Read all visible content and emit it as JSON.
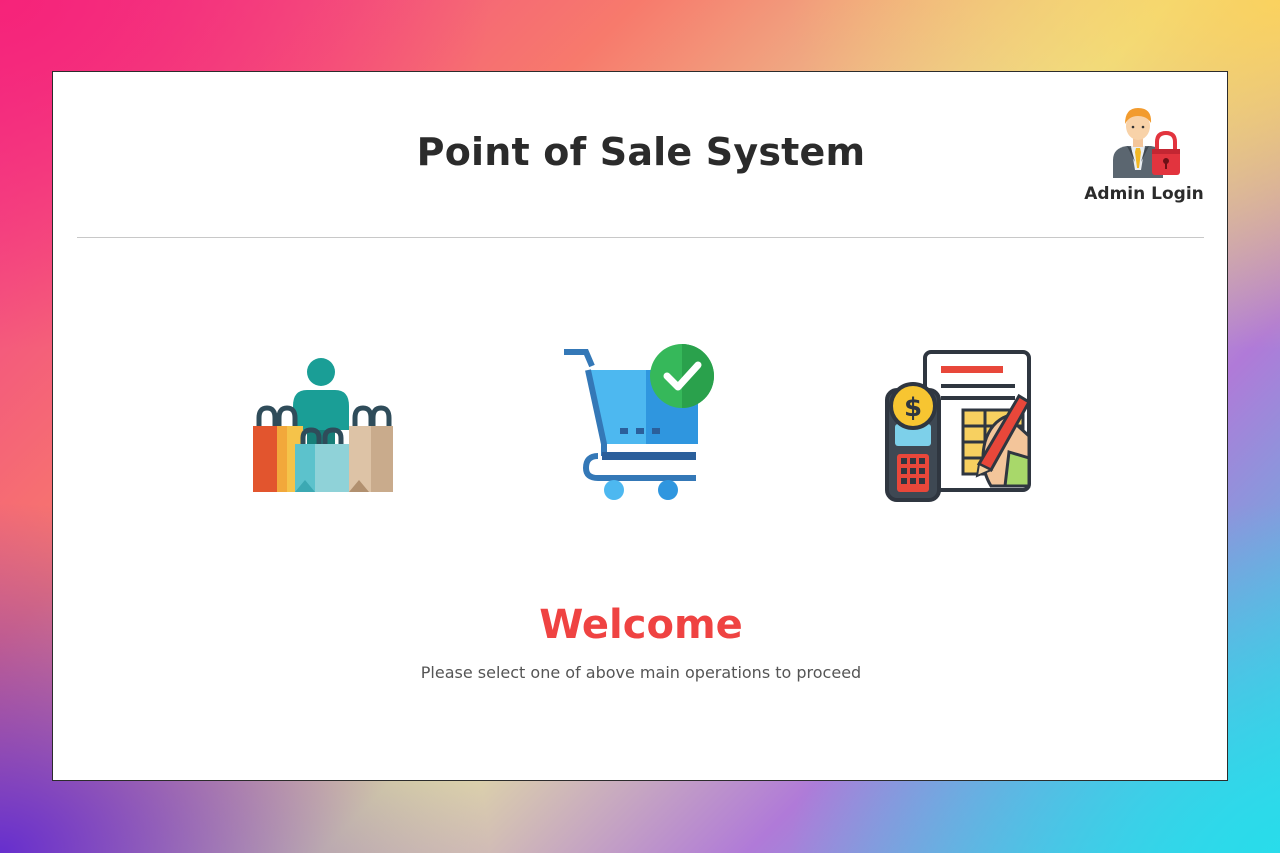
{
  "app": {
    "title": "Point of Sale System"
  },
  "header": {
    "admin_login_label": "Admin Login",
    "admin_icon": "admin-lock-icon"
  },
  "operations": [
    {
      "icon": "customers-shopping-bags-icon"
    },
    {
      "icon": "shopping-cart-check-icon"
    },
    {
      "icon": "billing-invoice-icon"
    }
  ],
  "welcome": {
    "heading": "Welcome",
    "message": "Please select one of above main operations to proceed"
  },
  "colors": {
    "welcome_red": "#ef4342",
    "title_text": "#2b2b2b",
    "subtitle_text": "#555555",
    "divider": "#c8c8c8"
  }
}
